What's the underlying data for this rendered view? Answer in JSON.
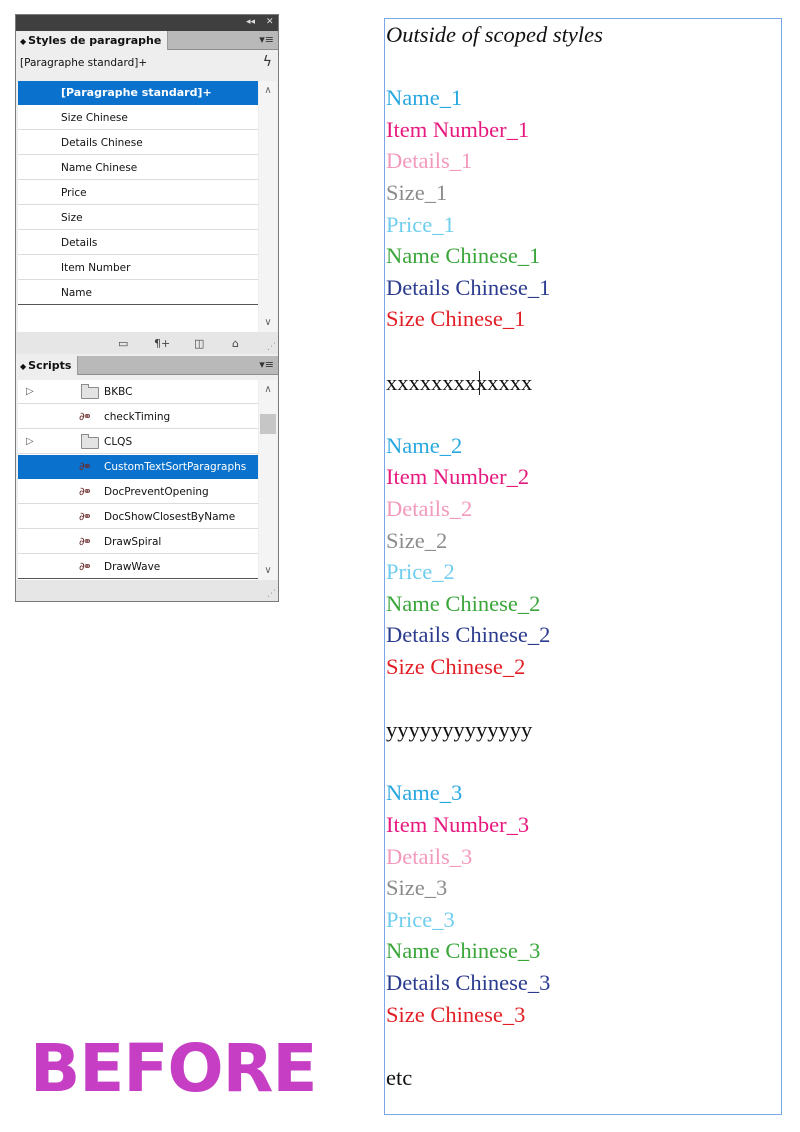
{
  "paragraph_styles_panel": {
    "tab_label": "Styles de paragraphe",
    "current_style": "[Paragraphe standard]+",
    "items": [
      {
        "label": "[Paragraphe standard]+",
        "selected": true
      },
      {
        "label": "Size Chinese"
      },
      {
        "label": "Details Chinese"
      },
      {
        "label": "Name Chinese"
      },
      {
        "label": "Price"
      },
      {
        "label": "Size"
      },
      {
        "label": "Details"
      },
      {
        "label": "Item Number"
      },
      {
        "label": "Name"
      }
    ],
    "footer_icons": [
      "folder-icon",
      "new-style-icon",
      "new-page-icon",
      "trash-icon"
    ]
  },
  "scripts_panel": {
    "tab_label": "Scripts",
    "items": [
      {
        "label": "BKBC",
        "type": "folder"
      },
      {
        "label": "checkTiming",
        "type": "script"
      },
      {
        "label": "CLQS",
        "type": "folder"
      },
      {
        "label": "CustomTextSortParagraphs",
        "type": "script",
        "selected": true
      },
      {
        "label": "DocPreventOpening",
        "type": "script"
      },
      {
        "label": "DocShowClosestByName",
        "type": "script"
      },
      {
        "label": "DrawSpiral",
        "type": "script"
      },
      {
        "label": "DrawWave",
        "type": "script"
      }
    ]
  },
  "before_label": "BEFORE",
  "document_text": {
    "intro": "Outside of scoped styles",
    "groups": [
      {
        "lines": [
          "Name_1",
          "Item Number_1",
          "Details_1",
          "Size_1",
          "Price_1",
          "Name Chinese_1",
          "Details Chinese_1",
          "Size Chinese_1"
        ],
        "separator": "xxxxxxxxxxxxx"
      },
      {
        "lines": [
          "Name_2",
          "Item Number_2",
          "Details_2",
          "Size_2",
          "Price_2",
          "Name Chinese_2",
          "Details Chinese_2",
          "Size Chinese_2"
        ],
        "separator": "yyyyyyyyyyyyy"
      },
      {
        "lines": [
          "Name_3",
          "Item Number_3",
          "Details_3",
          "Size_3",
          "Price_3",
          "Name Chinese_3",
          "Details Chinese_3",
          "Size Chinese_3"
        ],
        "separator": "etc"
      }
    ],
    "style_colors": [
      "#29a8e0",
      "#e6197f",
      "#f399bd",
      "#8c8c8c",
      "#6fcdee",
      "#3aa63a",
      "#2b3b8e",
      "#e21e25"
    ],
    "plain_color": "#111111"
  }
}
